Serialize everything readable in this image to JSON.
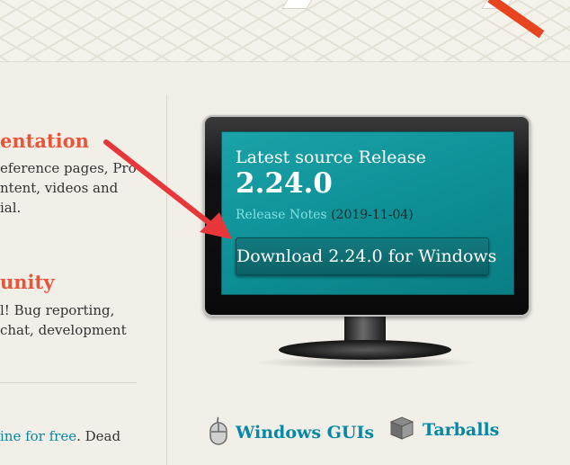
{
  "sections": {
    "documentation": {
      "title": "entation",
      "lines": [
        "eference pages, Pro",
        "ntent, videos and",
        "ial."
      ]
    },
    "community": {
      "title": "unity",
      "lines": [
        "l! Bug reporting,",
        " chat, development"
      ]
    },
    "book": {
      "link": "ine for free",
      "rest": ". Dead"
    }
  },
  "release": {
    "label": "Latest source Release",
    "version": "2.24.0",
    "notes_link": "Release Notes",
    "date": "(2019-11-04)",
    "download_button": "Download 2.24.0 for Windows"
  },
  "downloads": {
    "gui": "Windows GUIs",
    "tarballs": "Tarballs"
  },
  "icons": {
    "gui": "mouse-icon",
    "tarballs": "box-icon",
    "arrow": "red-annotation-arrow"
  },
  "colors": {
    "accent_red": "#e8553a",
    "link": "#0388a6",
    "screen": "#0d8e95"
  }
}
